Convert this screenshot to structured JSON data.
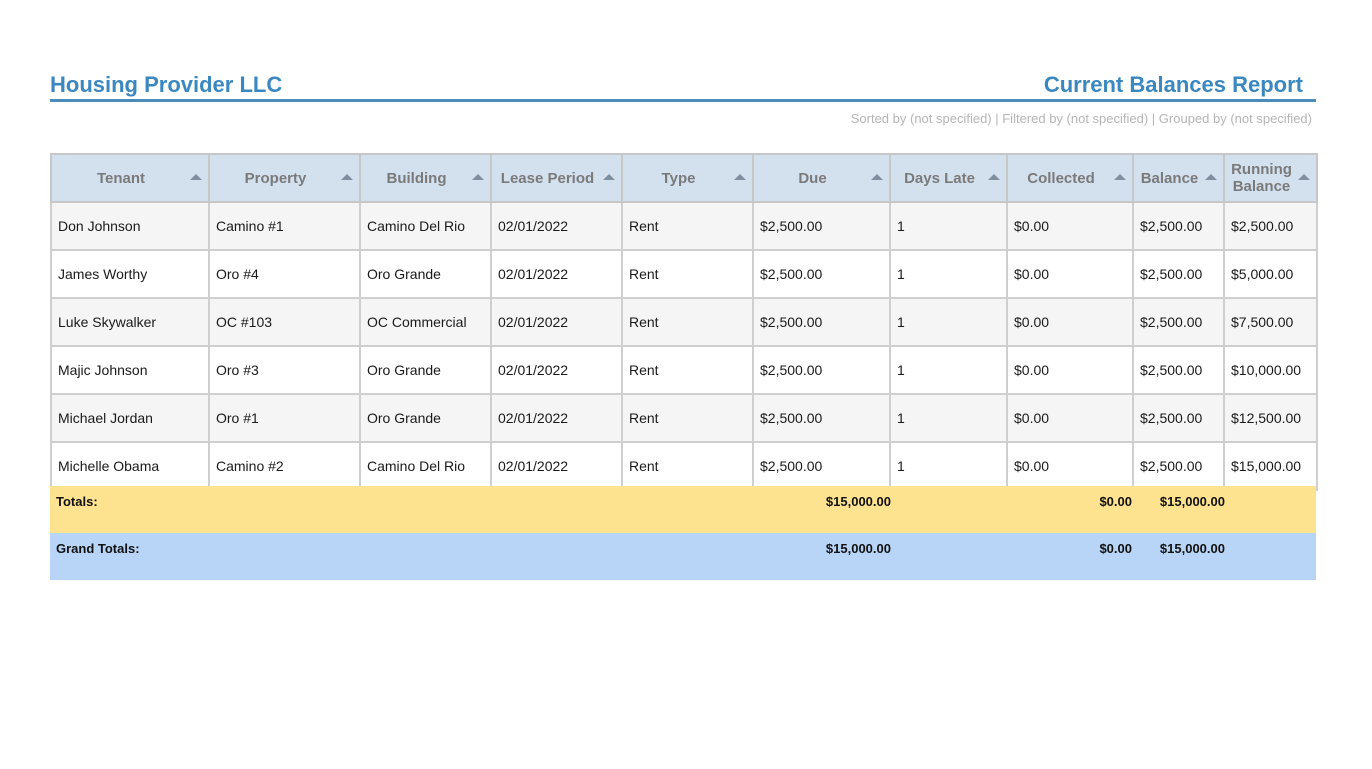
{
  "company": "Housing Provider LLC",
  "report_title": "Current Balances Report",
  "subinfo": "Sorted by (not specified) | Filtered by (not specified) | Grouped by (not specified)",
  "columns": [
    "Tenant",
    "Property",
    "Building",
    "Lease Period",
    "Type",
    "Due",
    "Days Late",
    "Collected",
    "Balance",
    "Running Balance"
  ],
  "rows": [
    [
      "Don Johnson",
      "Camino #1",
      "Camino Del Rio",
      "02/01/2022",
      "Rent",
      "$2,500.00",
      "1",
      "$0.00",
      "$2,500.00",
      "$2,500.00"
    ],
    [
      "James Worthy",
      "Oro #4",
      "Oro Grande",
      "02/01/2022",
      "Rent",
      "$2,500.00",
      "1",
      "$0.00",
      "$2,500.00",
      "$5,000.00"
    ],
    [
      "Luke Skywalker",
      "OC #103",
      "OC Commercial",
      "02/01/2022",
      "Rent",
      "$2,500.00",
      "1",
      "$0.00",
      "$2,500.00",
      "$7,500.00"
    ],
    [
      "Majic Johnson",
      "Oro #3",
      "Oro Grande",
      "02/01/2022",
      "Rent",
      "$2,500.00",
      "1",
      "$0.00",
      "$2,500.00",
      "$10,000.00"
    ],
    [
      "Michael Jordan",
      "Oro #1",
      "Oro Grande",
      "02/01/2022",
      "Rent",
      "$2,500.00",
      "1",
      "$0.00",
      "$2,500.00",
      "$12,500.00"
    ],
    [
      "Michelle Obama",
      "Camino #2",
      "Camino Del Rio",
      "02/01/2022",
      "Rent",
      "$2,500.00",
      "1",
      "$0.00",
      "$2,500.00",
      "$15,000.00"
    ]
  ],
  "totals": {
    "label": "Totals:",
    "due": "$15,000.00",
    "collected": "$0.00",
    "balance": "$15,000.00"
  },
  "grand_totals": {
    "label": "Grand Totals:",
    "due": "$15,000.00",
    "collected": "$0.00",
    "balance": "$15,000.00"
  },
  "colors": {
    "accent": "#3a88bf",
    "header_bg": "#d3e1ef",
    "totals_bg": "#fde38f",
    "grand_totals_bg": "#b8d5f7"
  },
  "icons": {
    "sort": "sort-ascending-icon"
  }
}
